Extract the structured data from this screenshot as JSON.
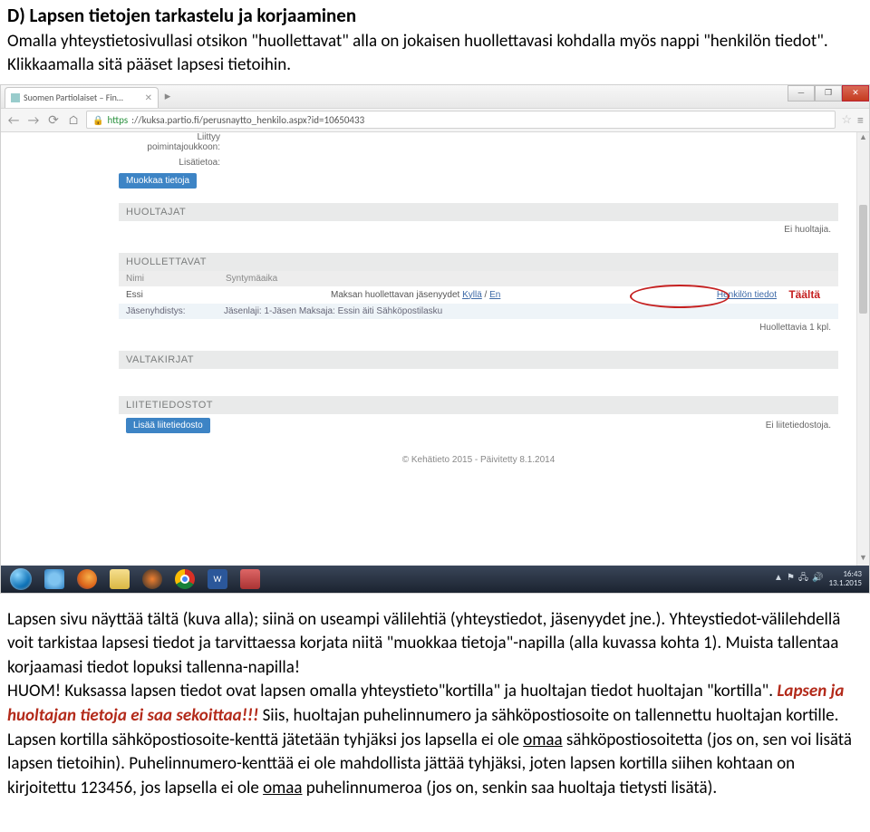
{
  "doc": {
    "heading": "D) Lapsen tietojen tarkastelu ja korjaaminen",
    "para1": "Omalla yhteystietosivullasi otsikon \"huollettavat\" alla on jokaisen huollettavasi kohdalla myös nappi \"henkilön tiedot\". Klikkaamalla sitä pääset lapsesi tietoihin.",
    "para2a": "Lapsen sivu näyttää tältä (kuva alla); siinä on useampi välilehtiä (yhteystiedot, jäsenyydet jne.). Yhteystiedot-välilehdellä voit tarkistaa lapsesi tiedot ja tarvittaessa korjata niitä \"muokkaa tietoja\"-napilla (alla kuvassa kohta 1). Muista tallentaa korjaamasi tiedot lopuksi tallenna-napilla!",
    "para2b": "HUOM! Kuksassa lapsen tiedot ovat lapsen omalla yhteystieto\"kortilla\" ja huoltajan tiedot huoltajan \"kortilla\". ",
    "para2hot": "Lapsen ja huoltajan tietoja ei saa sekoittaa!!!",
    "para2c": " Siis, huoltajan puhelinnumero ja sähköpostiosoite on tallennettu huoltajan kortille. Lapsen kortilla sähköpostiosoite-kenttä jätetään tyhjäksi jos lapsella ei ole ",
    "para2u1": "omaa",
    "para2d": " sähköpostiosoitetta (jos on, sen voi lisätä lapsen tietoihin). Puhelinnumero-kenttää ei ole mahdollista jättää tyhjäksi, joten lapsen kortilla siihen kohtaan on kirjoitettu 123456, jos lapsella ei ole ",
    "para2u2": "omaa",
    "para2e": " puhelinnumeroa (jos on, senkin saa huoltaja tietysti lisätä)."
  },
  "browser": {
    "tab_title": "Suomen Partiolaiset – Fin…",
    "url_https": "https",
    "url_rest": "://kuksa.partio.fi/perusnaytto_henkilo.aspx?id=10650433",
    "win_min": "—",
    "win_max": "❐",
    "win_close": "✕"
  },
  "page": {
    "liittyy_label": "Liittyy",
    "poimintajoukkoon_label": "poimintajoukkoon:",
    "lisatietoa_label": "Lisätietoa:",
    "muokkaa_btn": "Muokkaa tietoja",
    "huoltajat_head": "HUOLTAJAT",
    "ei_huoltajia": "Ei huoltajia.",
    "huollettavat_head": "HUOLLETTAVAT",
    "col_nimi": "Nimi",
    "col_syntymaaika": "Syntymäaika",
    "row_name": "Essi",
    "row_maksan": "Maksan huollettavan jäsenyydet ",
    "kylla": "Kyllä",
    "sep": " / ",
    "en": "En",
    "henkilon_tiedot": "Henkilön tiedot",
    "taalta": "Täältä",
    "jy_label": "Jäsenyhdistys:",
    "jy_value": "Jäsenlaji: 1-Jäsen  Maksaja: Essin äiti Sähköpostilasku",
    "huollettavia": "Huollettavia 1 kpl.",
    "valtakirjat_head": "VALTAKIRJAT",
    "liitetiedostot_head": "LIITETIEDOSTOT",
    "lisaa_liitetiedosto": "Lisää liitetiedosto",
    "ei_liitetiedostoja": "Ei liitetiedostoja.",
    "footer": "© Kehätieto 2015 - Päivitetty 8.1.2014"
  },
  "taskbar": {
    "word_letter": "W",
    "time": "16:43",
    "date": "13.1.2015",
    "tray_up": "▲"
  }
}
